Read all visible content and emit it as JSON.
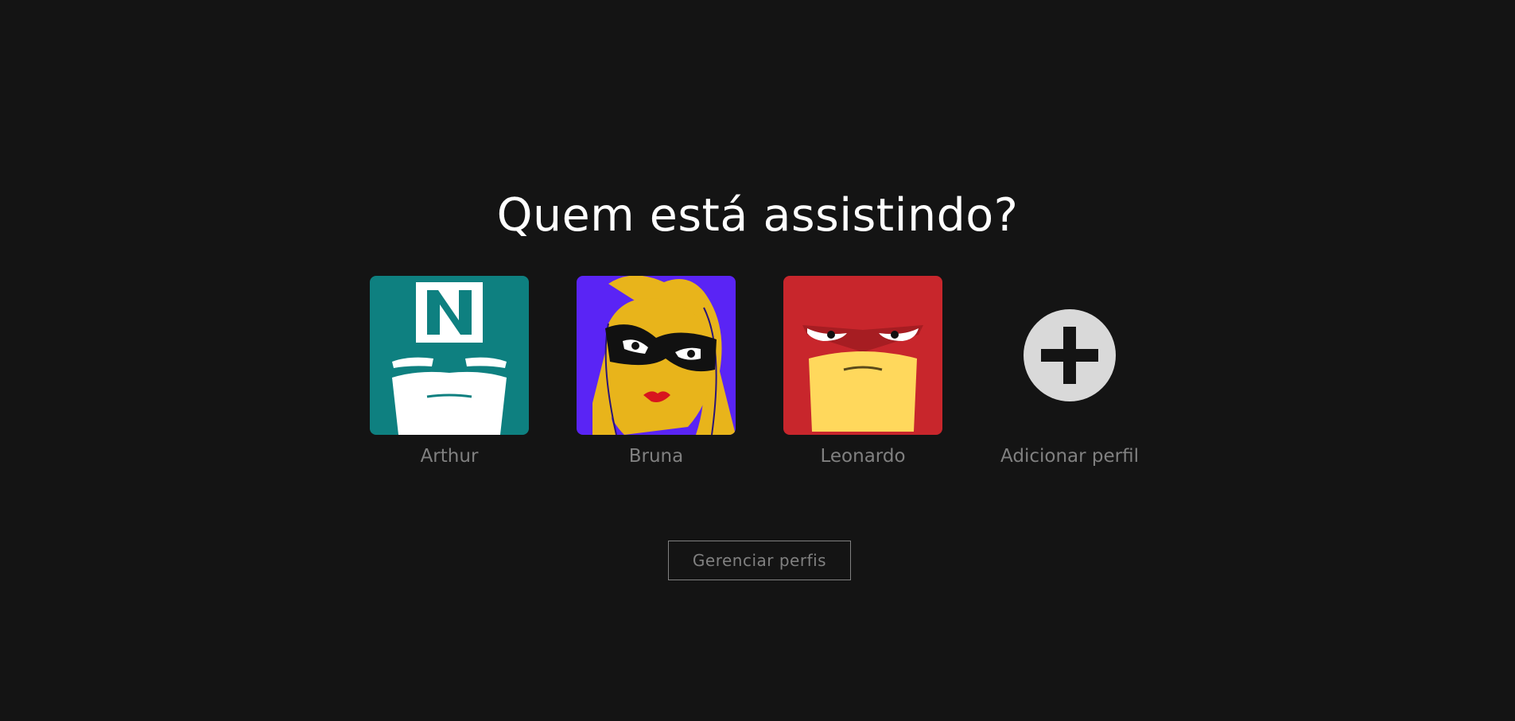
{
  "page": {
    "title": "Quem está assistindo?"
  },
  "profiles": [
    {
      "name": "Arthur",
      "avatar_icon": "masked-hero-n-icon",
      "avatar_color": "#0e8080"
    },
    {
      "name": "Bruna",
      "avatar_icon": "masked-heroine-icon",
      "avatar_color": "#5a24f5"
    },
    {
      "name": "Leonardo",
      "avatar_icon": "red-hooded-hero-icon",
      "avatar_color": "#c8262c"
    },
    {
      "name": "Adicionar perfil",
      "avatar_icon": "plus-circle-icon",
      "avatar_color": "#d9d9d9"
    }
  ],
  "actions": {
    "manage_label": "Gerenciar perfis"
  },
  "colors": {
    "background": "#141414",
    "muted_text": "#808080"
  }
}
